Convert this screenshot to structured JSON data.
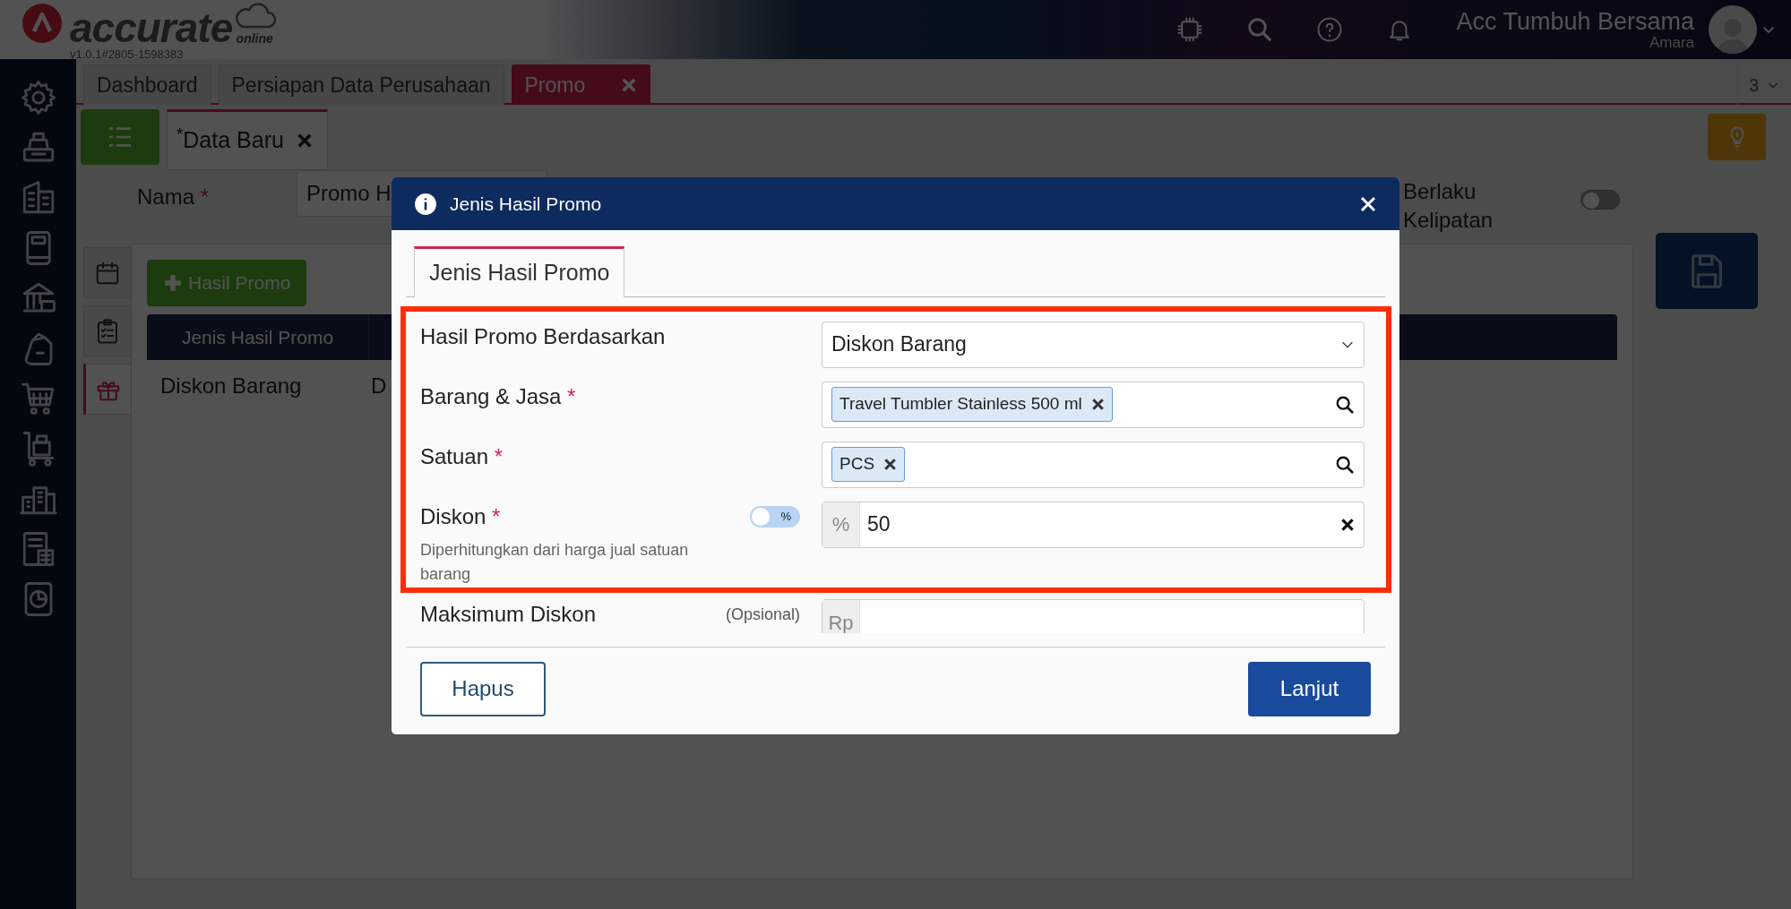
{
  "header": {
    "logo_text": "accurate",
    "logo_subtext": "online",
    "version": "v1.0.1#2805-1598383",
    "company": "Acc Tumbuh Bersama",
    "user": "Amara"
  },
  "tabs": [
    {
      "label": "Dashboard",
      "selected": false,
      "closable": false
    },
    {
      "label": "Persiapan Data Perusahaan",
      "selected": false,
      "closable": false
    },
    {
      "label": "Promo",
      "selected": true,
      "closable": true
    }
  ],
  "tab_count": "3",
  "sub_tabs": [
    {
      "label": "Data Baru",
      "marker": "*",
      "selected": true,
      "closable": true
    }
  ],
  "form": {
    "name_label": "Nama",
    "name_mark": "*",
    "name_value": "Promo H",
    "multiple_label": "Berlaku Kelipatan",
    "multiple_on": false
  },
  "side_tabs": [
    {
      "kind": "calendar",
      "selected": false
    },
    {
      "kind": "checklist",
      "selected": false
    },
    {
      "kind": "gift",
      "selected": true
    }
  ],
  "add_button": "Hasil Promo",
  "table": {
    "columns": [
      "Jenis Hasil Promo"
    ],
    "rows": [
      [
        "Diskon Barang",
        "D"
      ]
    ]
  },
  "modal": {
    "title": "Jenis Hasil Promo",
    "tabs": [
      {
        "label": "Jenis Hasil Promo",
        "selected": true
      }
    ],
    "fields": [
      {
        "kind": "select",
        "label": "Hasil Promo Berdasarkan",
        "value": "Diskon Barang",
        "highlighted": true
      },
      {
        "kind": "tags",
        "label": "Barang & Jasa",
        "mark": "*",
        "tags": [
          "Travel Tumbler Stainless 500 ml"
        ],
        "highlighted": true
      },
      {
        "kind": "tags",
        "label": "Satuan",
        "mark": "*",
        "tags": [
          "PCS"
        ],
        "highlighted": true
      },
      {
        "kind": "number",
        "label": "Diskon",
        "mark": "*",
        "prefix": "%",
        "value": "50",
        "toggle": {
          "label": "%",
          "on": false
        },
        "hint": "Diperhitungkan dari harga jual satuan barang",
        "highlighted": true
      },
      {
        "kind": "number",
        "label": "Maksimum Diskon",
        "optional": "(Opsional)",
        "prefix": "Rp",
        "highlighted": false
      }
    ],
    "buttons": [
      {
        "label": "Hapus",
        "kind": "outline"
      },
      {
        "label": "Lanjut",
        "kind": "primary"
      }
    ]
  }
}
